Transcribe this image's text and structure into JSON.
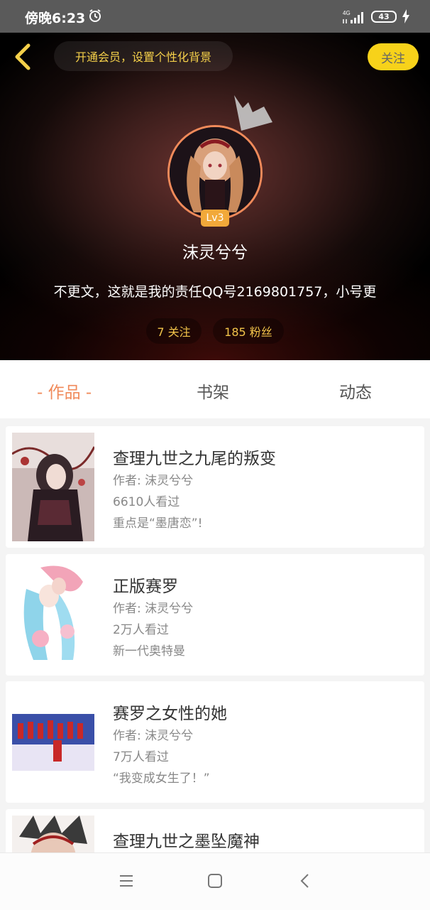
{
  "status_bar": {
    "time": "傍晚6:23",
    "network": "4G",
    "battery": "43"
  },
  "header": {
    "vip_text": "开通会员，设置个性化背景",
    "follow_label": "关注",
    "level": "Lv3",
    "username": "沫灵兮兮",
    "bio": "不更文，这就是我的责任QQ号2169801757，小号更",
    "following": "7 关注",
    "followers": "185 粉丝"
  },
  "tabs": [
    {
      "label": "- 作品 -",
      "active": true
    },
    {
      "label": "书架",
      "active": false
    },
    {
      "label": "动态",
      "active": false
    }
  ],
  "works": [
    {
      "title": "查理九世之九尾的叛变",
      "author": "作者: 沫灵兮兮",
      "views": "6610人看过",
      "desc": "重点是“墨唐恋”!"
    },
    {
      "title": "正版赛罗",
      "author": "作者: 沫灵兮兮",
      "views": "2万人看过",
      "desc": "新一代奥特曼"
    },
    {
      "title": "赛罗之女性的她",
      "author": "作者: 沫灵兮兮",
      "views": "7万人看过",
      "desc": "“我变成女生了！”"
    },
    {
      "title": "查理九世之墨坠魔神"
    }
  ],
  "colors": {
    "accent": "#f08a5a",
    "follow_bg": "#f7d21a",
    "vip_text": "#f5d04a",
    "stat_text": "#f2c44a"
  },
  "icons": {
    "back": "back-arrow-icon",
    "crown": "crown-icon",
    "menu": "menu-icon",
    "home": "home-icon",
    "nav_back": "nav-back-icon"
  }
}
